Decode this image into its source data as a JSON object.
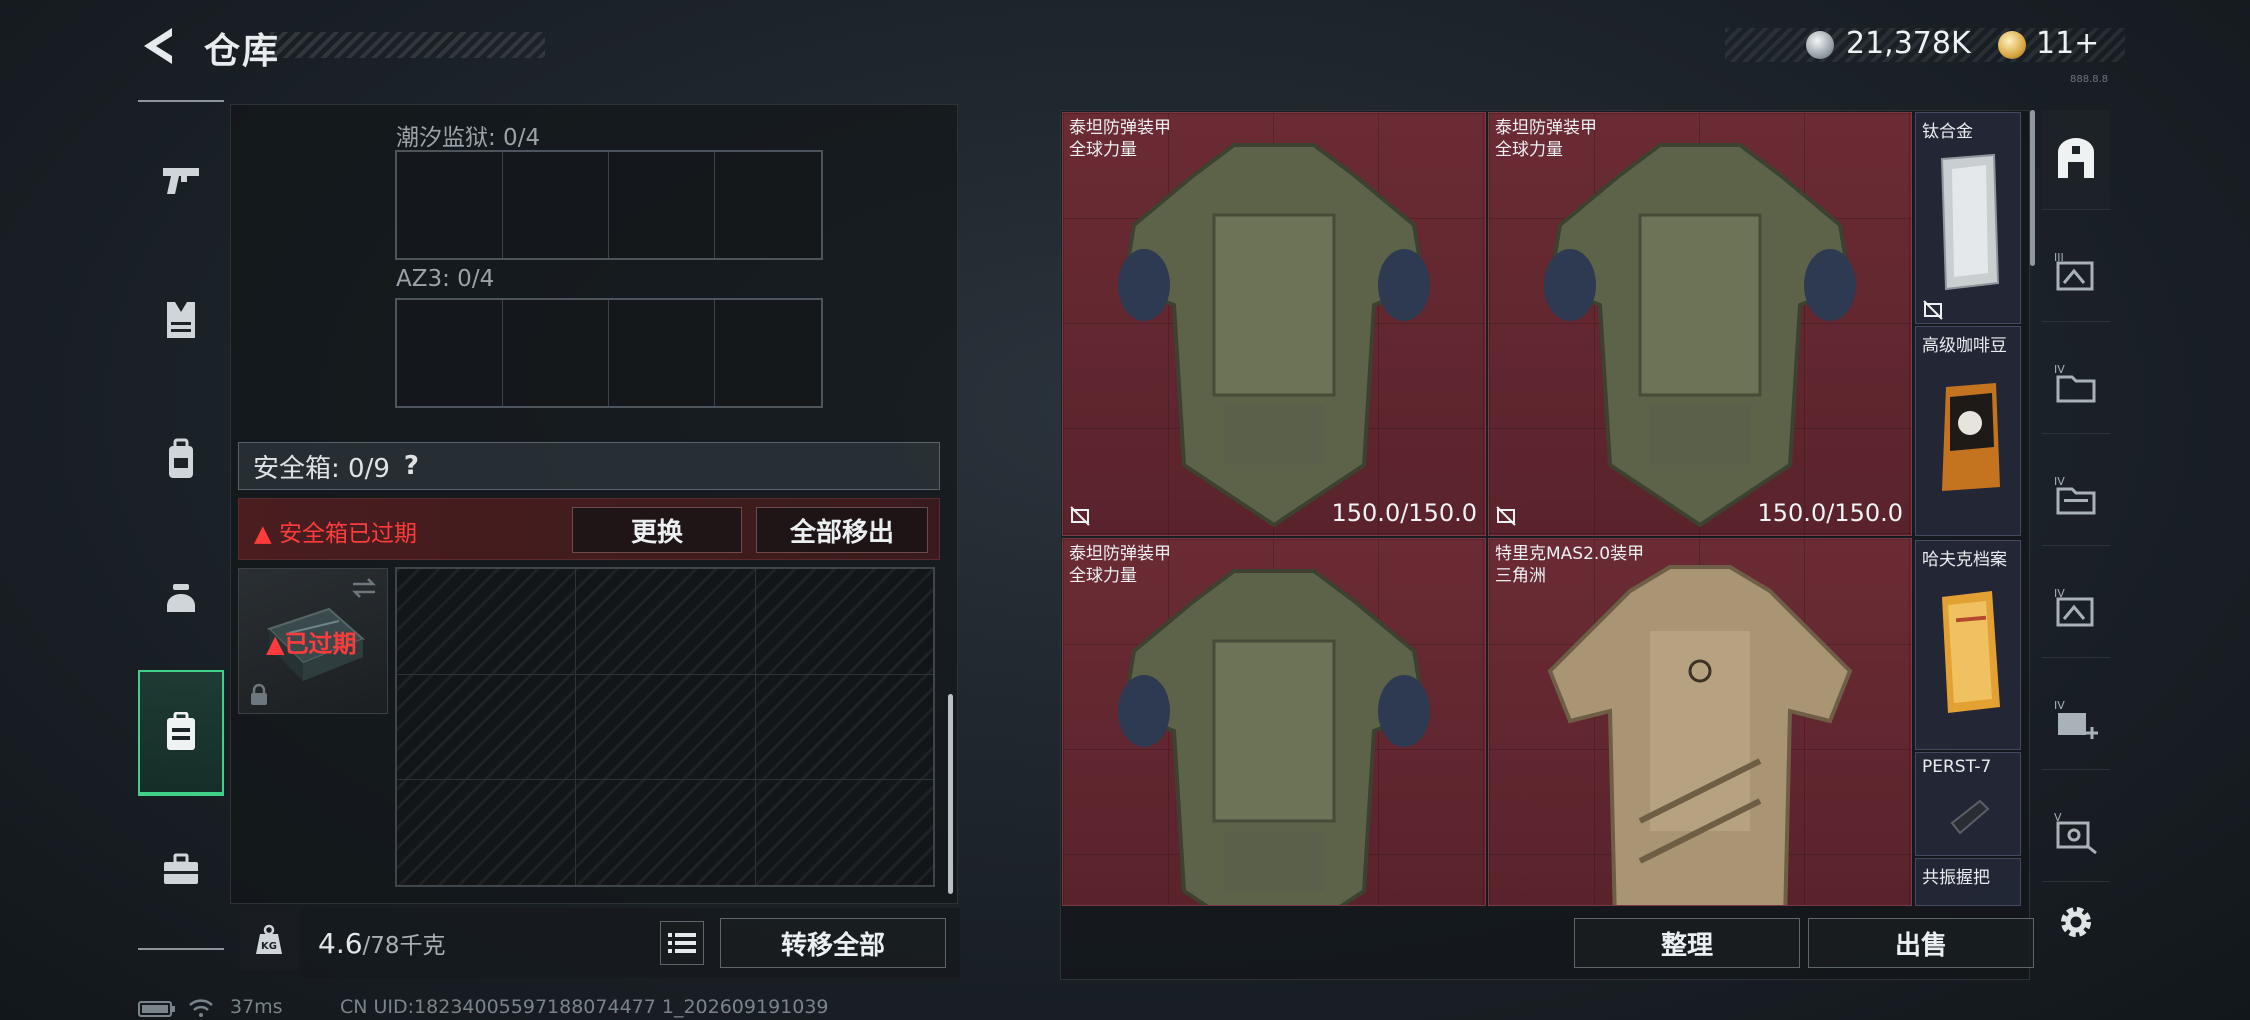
{
  "header": {
    "title": "仓库",
    "currency_silver": "21,378K",
    "currency_gold": "11+",
    "version": "888.8.8"
  },
  "nav": {
    "items": [
      "pistol-icon",
      "vest-icon",
      "backpack-icon",
      "helmet-icon",
      "safebox-icon",
      "briefcase-icon"
    ],
    "active_index": 4
  },
  "left_panel": {
    "slot1_label": "潮汐监狱: 0/4",
    "slot2_label": "AZ3: 0/4",
    "safe_header": "安全箱: 0/9",
    "safe_help": "?",
    "warning_text": "▲ 安全箱已过期",
    "replace_button": "更换",
    "remove_all_button": "全部移出",
    "expired_label": "▲已过期",
    "weight_value": "4.6",
    "weight_unit": "/78千克",
    "kg_label": "KG",
    "transfer_all_button": "转移全部"
  },
  "items": [
    {
      "name": "泰坦防弹装甲",
      "sub": "全球力量",
      "durability": "150.0/150.0"
    },
    {
      "name": "泰坦防弹装甲",
      "sub": "全球力量",
      "durability": "150.0/150.0"
    },
    {
      "name": "泰坦防弹装甲",
      "sub": "全球力量",
      "durability": ""
    },
    {
      "name": "特里克MAS2.0装甲",
      "sub": "三角洲",
      "durability": ""
    }
  ],
  "side_items": [
    {
      "name": "钛合金"
    },
    {
      "name": "高级咖啡豆"
    },
    {
      "name": "哈夫克档案"
    },
    {
      "name": "PERST-7"
    },
    {
      "name": "共振握把"
    }
  ],
  "right_panel": {
    "sort_button": "整理",
    "sell_button": "出售"
  },
  "status": {
    "ping": "37ms",
    "uid": "CN UID:18234005597188074477 1_202609191039"
  },
  "colors": {
    "accent_green": "#3fd08c",
    "item_bg": "#6b2b34",
    "warning_red": "#ff3b3b"
  }
}
